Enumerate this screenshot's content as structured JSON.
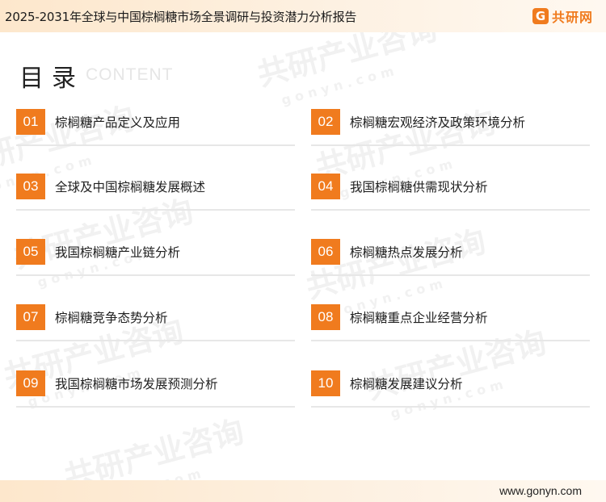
{
  "header": {
    "title": "2025-2031年全球与中国棕榈糖市场全景调研与投资潜力分析报告",
    "brand_icon": "G",
    "brand_name": "共研网",
    "accent": "#f07b1e"
  },
  "watermark": {
    "brand": "共研产业咨询",
    "domain": "g o n y n . c o m"
  },
  "toc": {
    "heading": "目录",
    "subheading": "CONTENT",
    "items": [
      {
        "num": "01",
        "label": "棕榈糖产品定义及应用"
      },
      {
        "num": "02",
        "label": "棕榈糖宏观经济及政策环境分析"
      },
      {
        "num": "03",
        "label": "全球及中国棕榈糖发展概述"
      },
      {
        "num": "04",
        "label": "我国棕榈糖供需现状分析"
      },
      {
        "num": "05",
        "label": "我国棕榈糖产业链分析"
      },
      {
        "num": "06",
        "label": "棕榈糖热点发展分析"
      },
      {
        "num": "07",
        "label": "棕榈糖竞争态势分析"
      },
      {
        "num": "08",
        "label": "棕榈糖重点企业经营分析"
      },
      {
        "num": "09",
        "label": "我国棕榈糖市场发展预测分析"
      },
      {
        "num": "10",
        "label": "棕榈糖发展建议分析"
      }
    ]
  },
  "footer": {
    "url": "www.gonyn.com"
  }
}
